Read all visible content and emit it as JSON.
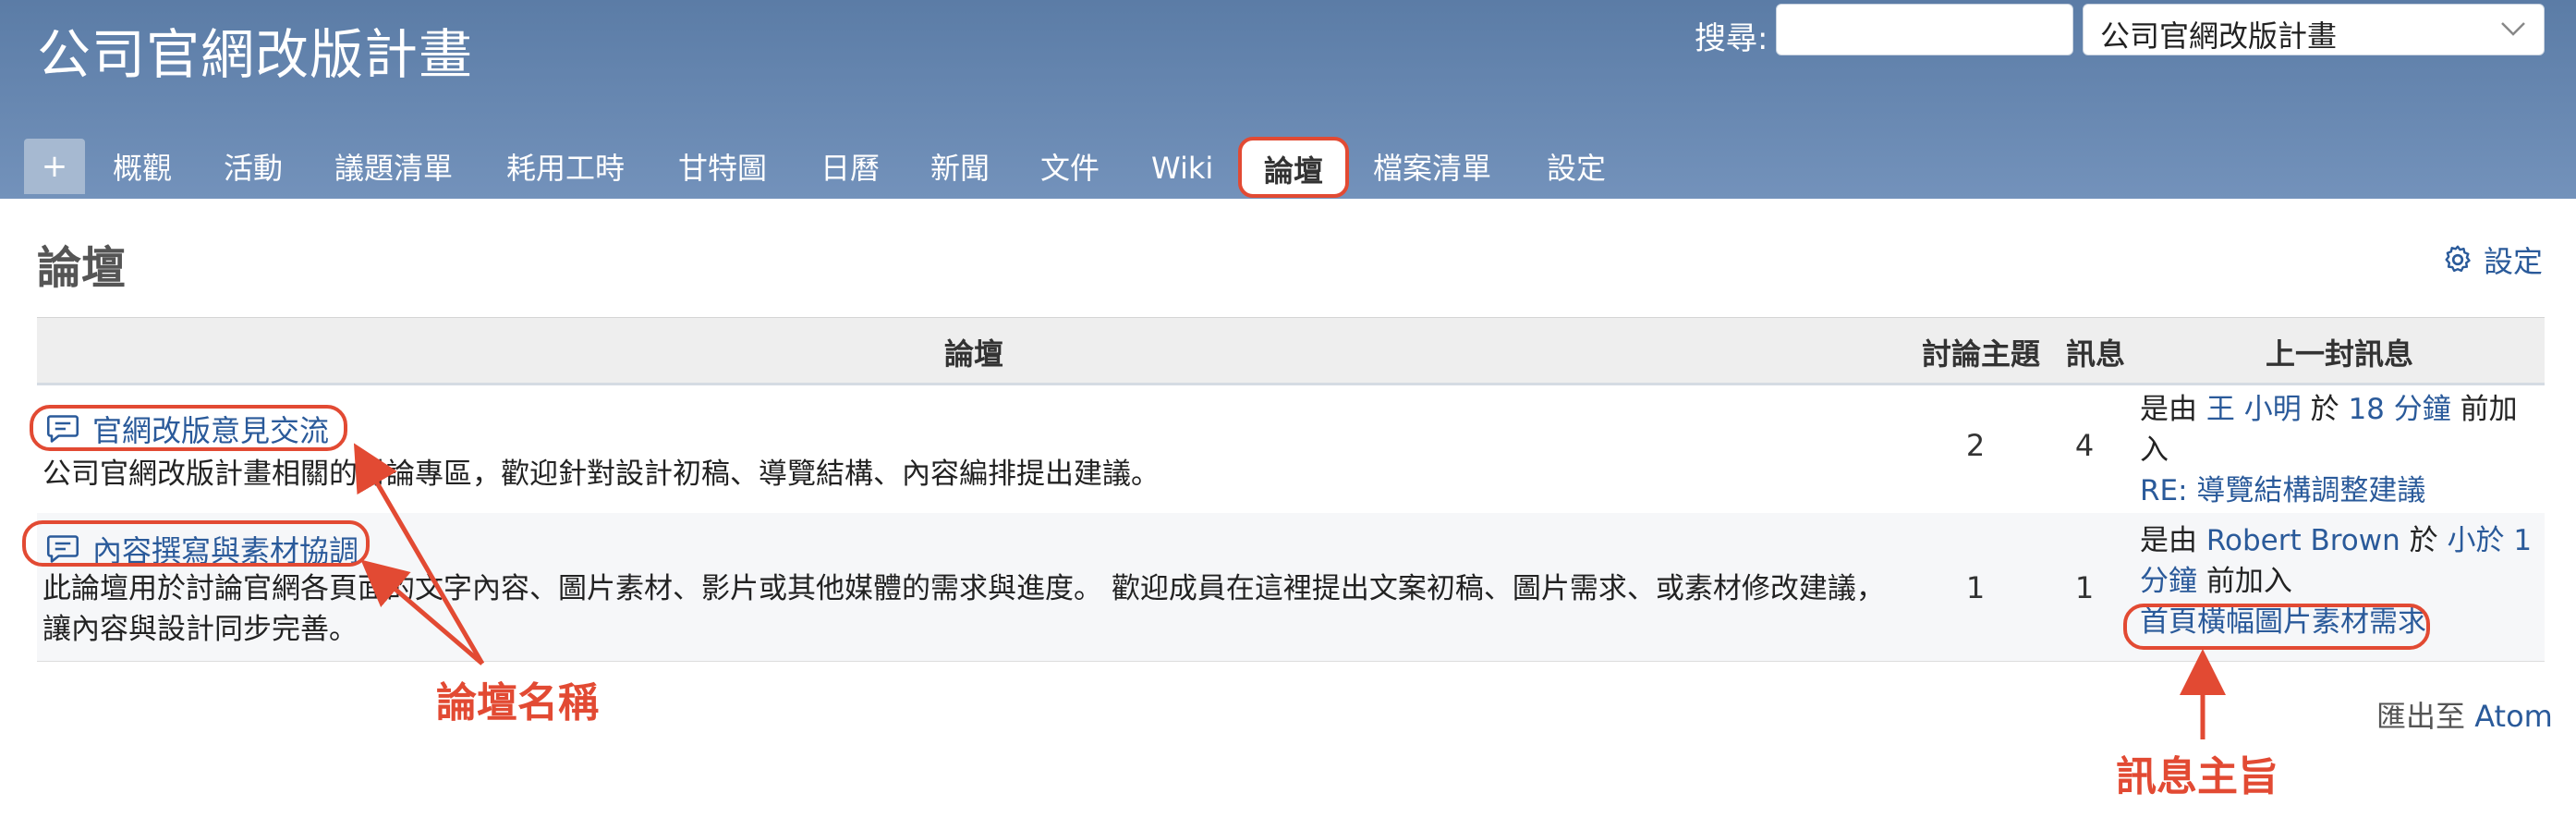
{
  "header": {
    "project_title": "公司官網改版計畫",
    "search_label": "搜尋:",
    "search_value": "",
    "project_select": "公司官網改版計畫"
  },
  "tabs": {
    "new": "+",
    "items": [
      "概觀",
      "活動",
      "議題清單",
      "耗用工時",
      "甘特圖",
      "日曆",
      "新聞",
      "文件",
      "Wiki",
      "論壇",
      "檔案清單",
      "設定"
    ],
    "selected": "論壇"
  },
  "page": {
    "title": "論壇",
    "settings_label": "設定"
  },
  "table": {
    "headers": [
      "論壇",
      "討論主題",
      "訊息",
      "上一封訊息"
    ],
    "rows": [
      {
        "name": "官網改版意見交流",
        "description": "公司官網改版計畫相關的討論專區，歡迎針對設計初稿、導覽結構、內容編排提出建議。",
        "topics": "2",
        "messages": "4",
        "last_prefix": "是由",
        "last_author": "王 小明",
        "last_mid": "於",
        "last_time": "18 分鐘",
        "last_suffix": "前加入",
        "last_subject": "RE: 導覽結構調整建議"
      },
      {
        "name": "內容撰寫與素材協調",
        "description": "此論壇用於討論官網各頁面的文字內容、圖片素材、影片或其他媒體的需求與進度。 歡迎成員在這裡提出文案初稿、圖片需求、或素材修改建議，讓內容與設計同步完善。",
        "topics": "1",
        "messages": "1",
        "last_prefix": "是由",
        "last_author": "Robert Brown",
        "last_mid": "於",
        "last_time": "小於 1 分鐘",
        "last_suffix": "前加入",
        "last_subject": "首頁橫幅圖片素材需求"
      }
    ]
  },
  "footer": {
    "export_label": "匯出至",
    "atom_label": "Atom"
  },
  "annotations": {
    "forum_name": "論壇名稱",
    "message_subject": "訊息主旨"
  },
  "colors": {
    "header_top": "#5b7ca6",
    "header_bottom": "#7392bb",
    "link": "#2a5a9a",
    "annotation": "#e24a33"
  }
}
